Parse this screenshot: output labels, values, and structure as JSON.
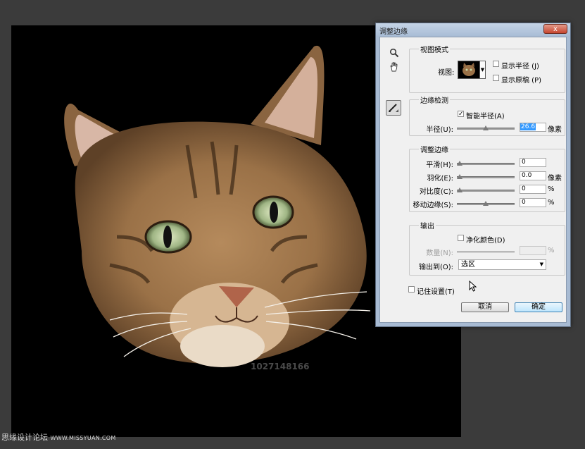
{
  "canvas": {
    "watermark_id": "1027148166",
    "site_watermark": "思缘设计论坛",
    "site_url": "WWW.MISSYUAN.COM"
  },
  "dialog": {
    "title": "调整边缘",
    "close_glyph": "x",
    "view_mode": {
      "title": "视图模式",
      "view_label": "视图:",
      "show_radius_label": "显示半径 (J)",
      "show_radius_checked": false,
      "show_original_label": "显示原稿 (P)",
      "show_original_checked": false
    },
    "edge_detection": {
      "title": "边缘检测",
      "smart_radius_label": "智能半径(A)",
      "smart_radius_checked": true,
      "radius_label": "半径(U):",
      "radius_value": "26.6",
      "radius_unit": "像素",
      "radius_slider_level": 0.5
    },
    "adjust_edge": {
      "title": "调整边缘",
      "smooth_label": "平滑(H):",
      "smooth_value": "0",
      "smooth_level": 0,
      "feather_label": "羽化(E):",
      "feather_value": "0.0",
      "feather_unit": "像素",
      "feather_level": 0,
      "contrast_label": "对比度(C):",
      "contrast_value": "0",
      "contrast_unit": "%",
      "contrast_level": 0,
      "shift_edge_label": "移动边缘(S):",
      "shift_edge_value": "0",
      "shift_edge_unit": "%",
      "shift_edge_level": 0.5
    },
    "output": {
      "title": "输出",
      "decontaminate_label": "净化颜色(D)",
      "decontaminate_checked": false,
      "amount_label": "数量(N):",
      "amount_unit": "%",
      "output_to_label": "输出到(O):",
      "output_to_value": "选区"
    },
    "remember_label": "记住设置(T)",
    "remember_checked": false,
    "cancel_label": "取消",
    "ok_label": "确定"
  },
  "icons": [
    "zoom-icon",
    "hand-icon",
    "refine-radius-brush-icon",
    "check-icon",
    "chevron-down-icon",
    "mouse-cursor-icon"
  ]
}
